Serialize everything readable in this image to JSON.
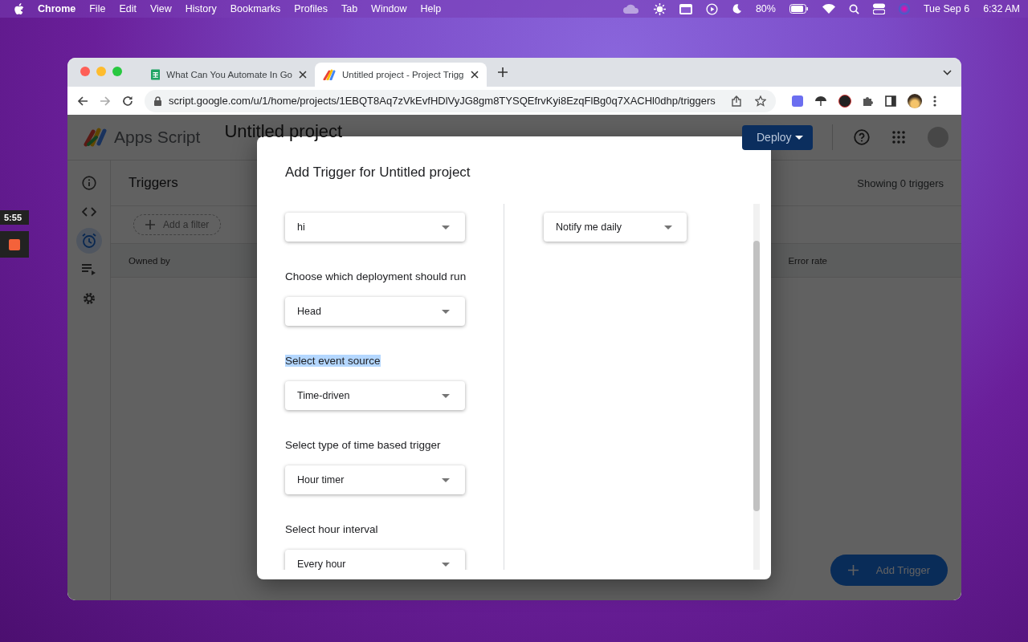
{
  "menu_bar": {
    "app": "Chrome",
    "items": [
      "File",
      "Edit",
      "View",
      "History",
      "Bookmarks",
      "Profiles",
      "Tab",
      "Window",
      "Help"
    ],
    "battery": "80%",
    "date": "Tue Sep 6",
    "time": "6:32 AM"
  },
  "recorder": {
    "elapsed": "5:55"
  },
  "browser": {
    "tabs": [
      {
        "title": "What Can You Automate In Go",
        "kind": "sheets",
        "selected": false
      },
      {
        "title": "Untitled project - Project Trigg",
        "kind": "script",
        "selected": true
      }
    ],
    "url": "script.google.com/u/1/home/projects/1EBQT8Aq7zVkEvfHDlVyJG8gm8TYSQEfrvKyi8EzqFlBg0q7XACHl0dhp/triggers"
  },
  "app": {
    "brand": "Apps Script",
    "project": "Untitled project",
    "deploy": "Deploy",
    "sidebar": [
      {
        "kind": "info",
        "selected": false
      },
      {
        "kind": "code",
        "selected": false
      },
      {
        "kind": "clock",
        "selected": true
      },
      {
        "kind": "list",
        "selected": false
      },
      {
        "kind": "gear",
        "selected": false
      }
    ],
    "page_title": "Triggers",
    "count": "Showing 0 triggers",
    "filter": "Add a filter",
    "table": {
      "columns": [
        "Owned by",
        "Error rate"
      ]
    },
    "fab": "Add Trigger"
  },
  "dialog": {
    "title": "Add Trigger for Untitled project",
    "left": [
      {
        "kind": "select",
        "text": "hi"
      },
      {
        "kind": "label",
        "text": "Choose which deployment should run",
        "highlighted": false
      },
      {
        "kind": "select",
        "text": "Head"
      },
      {
        "kind": "label",
        "text": "Select event source",
        "highlighted": true
      },
      {
        "kind": "select",
        "text": "Time-driven"
      },
      {
        "kind": "label",
        "text": "Select type of time based trigger",
        "highlighted": false
      },
      {
        "kind": "select",
        "text": "Hour timer"
      },
      {
        "kind": "label",
        "text": "Select hour interval",
        "highlighted": false
      },
      {
        "kind": "select",
        "text": "Every hour"
      }
    ],
    "right": [
      {
        "kind": "select",
        "text": "Notify me daily"
      }
    ]
  }
}
